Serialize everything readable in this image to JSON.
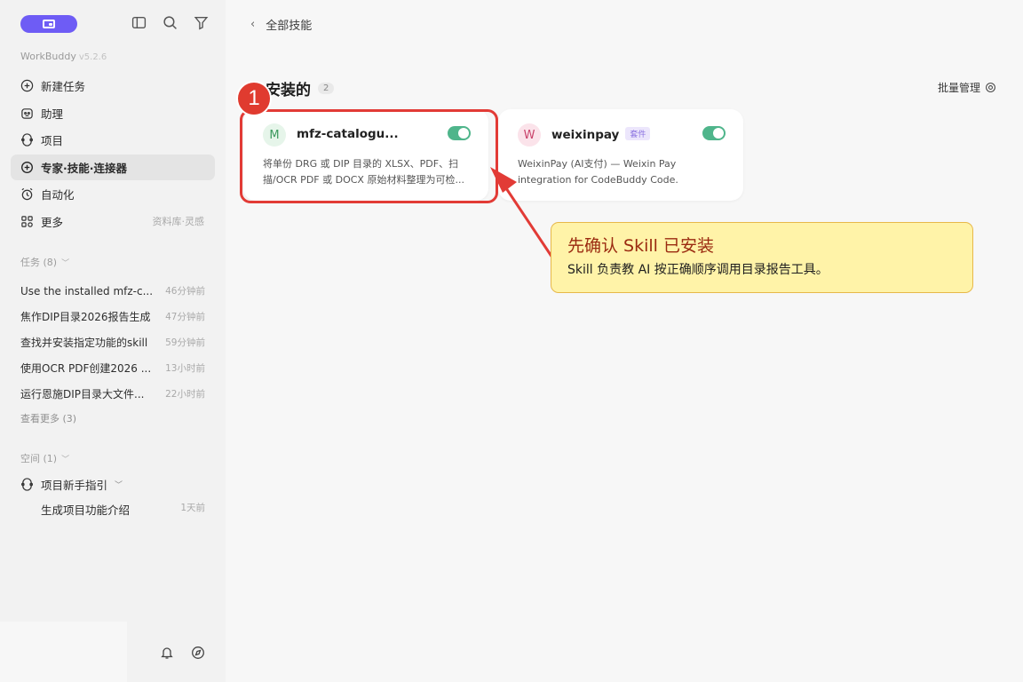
{
  "sidebar": {
    "app_name": "WorkBuddy",
    "version": "v5.2.6",
    "nav": [
      {
        "label": "新建任务",
        "right": ""
      },
      {
        "label": "助理",
        "right": ""
      },
      {
        "label": "项目",
        "right": ""
      },
      {
        "label": "专家·技能·连接器",
        "right": ""
      },
      {
        "label": "自动化",
        "right": ""
      },
      {
        "label": "更多",
        "right": "资料库·灵感"
      }
    ],
    "tasks_header": "任务 (8)",
    "tasks": [
      {
        "title": "Use the installed mfz-c...",
        "time": "46分钟前"
      },
      {
        "title": "焦作DIP目录2026报告生成",
        "time": "47分钟前"
      },
      {
        "title": "查找并安装指定功能的skill",
        "time": "59分钟前"
      },
      {
        "title": "使用OCR PDF创建2026 ...",
        "time": "13小时前"
      },
      {
        "title": "运行恩施DIP目录大文件...",
        "time": "22小时前"
      }
    ],
    "see_more": "查看更多 (3)",
    "spaces_header": "空间 (1)",
    "space_name": "项目新手指引",
    "space_sub": {
      "title": "生成项目功能介绍",
      "time": "1天前"
    }
  },
  "main": {
    "back_label": "全部技能",
    "installed_title": "安装的",
    "installed_count": "2",
    "manage_label": "批量管理",
    "cards": [
      {
        "avatar": "M",
        "name": "mfz-catalogu...",
        "tag": "",
        "enabled": true,
        "desc": "将单份 DRG 或 DIP 目录的 XLSX、PDF、扫描/OCR PDF 或 DOCX 原始材料整理为可检..."
      },
      {
        "avatar": "W",
        "name": "weixinpay",
        "tag": "套件",
        "enabled": true,
        "desc": "WeixinPay (AI支付) — Weixin Pay integration for CodeBuddy Code."
      }
    ]
  },
  "annotation": {
    "step_number": "1",
    "callout_title": "先确认 Skill 已安装",
    "callout_body": "Skill 负责教 AI 按正确顺序调用目录报告工具。"
  },
  "colors": {
    "accent": "#6e5cf5",
    "toggle_on": "#4fb58b",
    "highlight_red": "#e23b36",
    "callout_bg": "#fff3a8"
  }
}
